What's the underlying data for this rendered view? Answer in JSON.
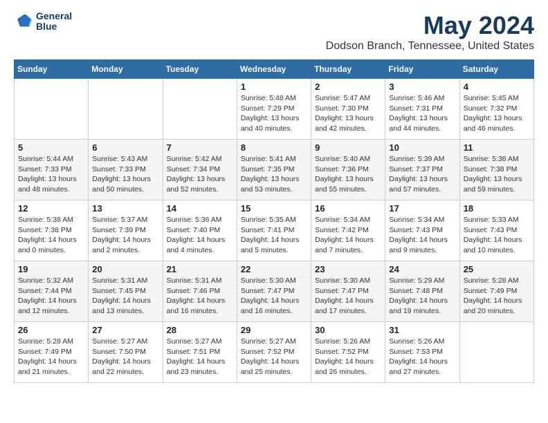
{
  "header": {
    "logo_line1": "General",
    "logo_line2": "Blue",
    "month_title": "May 2024",
    "location": "Dodson Branch, Tennessee, United States"
  },
  "days_of_week": [
    "Sunday",
    "Monday",
    "Tuesday",
    "Wednesday",
    "Thursday",
    "Friday",
    "Saturday"
  ],
  "weeks": [
    [
      {
        "day": "",
        "info": ""
      },
      {
        "day": "",
        "info": ""
      },
      {
        "day": "",
        "info": ""
      },
      {
        "day": "1",
        "info": "Sunrise: 5:48 AM\nSunset: 7:29 PM\nDaylight: 13 hours\nand 40 minutes."
      },
      {
        "day": "2",
        "info": "Sunrise: 5:47 AM\nSunset: 7:30 PM\nDaylight: 13 hours\nand 42 minutes."
      },
      {
        "day": "3",
        "info": "Sunrise: 5:46 AM\nSunset: 7:31 PM\nDaylight: 13 hours\nand 44 minutes."
      },
      {
        "day": "4",
        "info": "Sunrise: 5:45 AM\nSunset: 7:32 PM\nDaylight: 13 hours\nand 46 minutes."
      }
    ],
    [
      {
        "day": "5",
        "info": "Sunrise: 5:44 AM\nSunset: 7:33 PM\nDaylight: 13 hours\nand 48 minutes."
      },
      {
        "day": "6",
        "info": "Sunrise: 5:43 AM\nSunset: 7:33 PM\nDaylight: 13 hours\nand 50 minutes."
      },
      {
        "day": "7",
        "info": "Sunrise: 5:42 AM\nSunset: 7:34 PM\nDaylight: 13 hours\nand 52 minutes."
      },
      {
        "day": "8",
        "info": "Sunrise: 5:41 AM\nSunset: 7:35 PM\nDaylight: 13 hours\nand 53 minutes."
      },
      {
        "day": "9",
        "info": "Sunrise: 5:40 AM\nSunset: 7:36 PM\nDaylight: 13 hours\nand 55 minutes."
      },
      {
        "day": "10",
        "info": "Sunrise: 5:39 AM\nSunset: 7:37 PM\nDaylight: 13 hours\nand 57 minutes."
      },
      {
        "day": "11",
        "info": "Sunrise: 5:38 AM\nSunset: 7:38 PM\nDaylight: 13 hours\nand 59 minutes."
      }
    ],
    [
      {
        "day": "12",
        "info": "Sunrise: 5:38 AM\nSunset: 7:38 PM\nDaylight: 14 hours\nand 0 minutes."
      },
      {
        "day": "13",
        "info": "Sunrise: 5:37 AM\nSunset: 7:39 PM\nDaylight: 14 hours\nand 2 minutes."
      },
      {
        "day": "14",
        "info": "Sunrise: 5:36 AM\nSunset: 7:40 PM\nDaylight: 14 hours\nand 4 minutes."
      },
      {
        "day": "15",
        "info": "Sunrise: 5:35 AM\nSunset: 7:41 PM\nDaylight: 14 hours\nand 5 minutes."
      },
      {
        "day": "16",
        "info": "Sunrise: 5:34 AM\nSunset: 7:42 PM\nDaylight: 14 hours\nand 7 minutes."
      },
      {
        "day": "17",
        "info": "Sunrise: 5:34 AM\nSunset: 7:43 PM\nDaylight: 14 hours\nand 9 minutes."
      },
      {
        "day": "18",
        "info": "Sunrise: 5:33 AM\nSunset: 7:43 PM\nDaylight: 14 hours\nand 10 minutes."
      }
    ],
    [
      {
        "day": "19",
        "info": "Sunrise: 5:32 AM\nSunset: 7:44 PM\nDaylight: 14 hours\nand 12 minutes."
      },
      {
        "day": "20",
        "info": "Sunrise: 5:31 AM\nSunset: 7:45 PM\nDaylight: 14 hours\nand 13 minutes."
      },
      {
        "day": "21",
        "info": "Sunrise: 5:31 AM\nSunset: 7:46 PM\nDaylight: 14 hours\nand 16 minutes."
      },
      {
        "day": "22",
        "info": "Sunrise: 5:30 AM\nSunset: 7:47 PM\nDaylight: 14 hours\nand 16 minutes."
      },
      {
        "day": "23",
        "info": "Sunrise: 5:30 AM\nSunset: 7:47 PM\nDaylight: 14 hours\nand 17 minutes."
      },
      {
        "day": "24",
        "info": "Sunrise: 5:29 AM\nSunset: 7:48 PM\nDaylight: 14 hours\nand 19 minutes."
      },
      {
        "day": "25",
        "info": "Sunrise: 5:28 AM\nSunset: 7:49 PM\nDaylight: 14 hours\nand 20 minutes."
      }
    ],
    [
      {
        "day": "26",
        "info": "Sunrise: 5:28 AM\nSunset: 7:49 PM\nDaylight: 14 hours\nand 21 minutes."
      },
      {
        "day": "27",
        "info": "Sunrise: 5:27 AM\nSunset: 7:50 PM\nDaylight: 14 hours\nand 22 minutes."
      },
      {
        "day": "28",
        "info": "Sunrise: 5:27 AM\nSunset: 7:51 PM\nDaylight: 14 hours\nand 23 minutes."
      },
      {
        "day": "29",
        "info": "Sunrise: 5:27 AM\nSunset: 7:52 PM\nDaylight: 14 hours\nand 25 minutes."
      },
      {
        "day": "30",
        "info": "Sunrise: 5:26 AM\nSunset: 7:52 PM\nDaylight: 14 hours\nand 26 minutes."
      },
      {
        "day": "31",
        "info": "Sunrise: 5:26 AM\nSunset: 7:53 PM\nDaylight: 14 hours\nand 27 minutes."
      },
      {
        "day": "",
        "info": ""
      }
    ]
  ]
}
